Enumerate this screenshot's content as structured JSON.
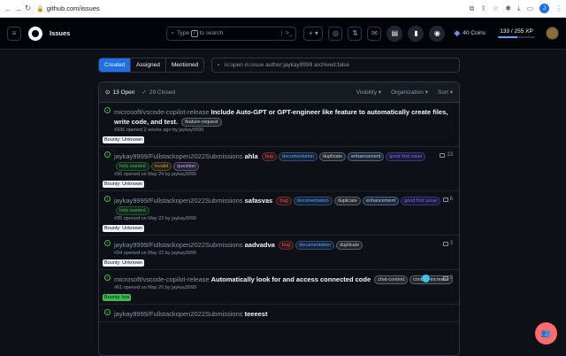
{
  "browser": {
    "url": "github.com/issues",
    "profile_initial": "J"
  },
  "header": {
    "context": "Issues",
    "search_placeholder": "Type / to search",
    "search_slash": "/",
    "search_cmd": ">_",
    "plus": "+ ▾",
    "coins": "40 Coins",
    "xp": "133 / 255 XP",
    "xp_fraction": 0.52
  },
  "filters": {
    "tabs": [
      "Created",
      "Assigned",
      "Mentioned"
    ],
    "query": "is:open is:issue author:jaykay9999 archived:false"
  },
  "list": {
    "open_count": "13 Open",
    "closed_count": "29 Closed",
    "sorts": [
      "Visibility ▾",
      "Organization ▾",
      "Sort ▾"
    ]
  },
  "issues": [
    {
      "repo": "microsoft/vscode-copilot-release",
      "title": "Include Auto-GPT or GPT-engineer like feature to automatically create files, write code, and test.",
      "labels": [
        {
          "text": "feature-request",
          "color": "#c9d1d9"
        }
      ],
      "meta": "#336 opened 2 weeks ago by jaykay9999",
      "comments": "",
      "bounty": "Bounty: Unknown"
    },
    {
      "repo": "jaykay9999/Fullstackopen2022Submissions",
      "title": "ahla",
      "labels": [
        {
          "text": "bug",
          "color": "#f85149"
        },
        {
          "text": "documentation",
          "color": "#58a6ff"
        },
        {
          "text": "duplicate",
          "color": "#c9d1d9"
        },
        {
          "text": "enhancement",
          "color": "#a5d6ff"
        },
        {
          "text": "good first issue",
          "color": "#7c6bff"
        },
        {
          "text": "help wanted",
          "color": "#3fb950"
        },
        {
          "text": "invalid",
          "color": "#d29922"
        },
        {
          "text": "question",
          "color": "#d2a8ff"
        }
      ],
      "meta": "#36 opened on May 24 by jaykay9999",
      "comments": "13",
      "bounty": "Bounty: Unknown"
    },
    {
      "repo": "jaykay9999/Fullstackopen2022Submissions",
      "title": "safasvas",
      "labels": [
        {
          "text": "bug",
          "color": "#f85149"
        },
        {
          "text": "documentation",
          "color": "#58a6ff"
        },
        {
          "text": "duplicate",
          "color": "#c9d1d9"
        },
        {
          "text": "enhancement",
          "color": "#a5d6ff"
        },
        {
          "text": "good first issue",
          "color": "#7c6bff"
        },
        {
          "text": "help wanted",
          "color": "#3fb950"
        }
      ],
      "meta": "#35 opened on May 22 by jaykay9999",
      "comments": "6",
      "bounty": "Bounty: Unknown"
    },
    {
      "repo": "jaykay9999/Fullstackopen2022Submissions",
      "title": "aadvadva",
      "labels": [
        {
          "text": "bug",
          "color": "#f85149"
        },
        {
          "text": "documentation",
          "color": "#58a6ff"
        },
        {
          "text": "duplicate",
          "color": "#c9d1d9"
        }
      ],
      "meta": "#34 opened on May 22 by jaykay9999",
      "comments": "3",
      "bounty": "Bounty: Unknown"
    },
    {
      "repo": "microsoft/vscode-copilot-release",
      "title": "Automatically look for and access connected code",
      "labels": [
        {
          "text": "chat-context",
          "color": "#c9d1d9"
        },
        {
          "text": "context-increase",
          "color": "#c9d1d9"
        }
      ],
      "meta": "#61 opened on May 20 by jaykay9999",
      "comments": "3",
      "bounty": "Bounty: low",
      "assignee": true
    },
    {
      "repo": "jaykay9999/Fullstackopen2022Submissions",
      "title": "teeeest",
      "labels": [],
      "meta": "",
      "comments": "",
      "bounty": ""
    }
  ]
}
